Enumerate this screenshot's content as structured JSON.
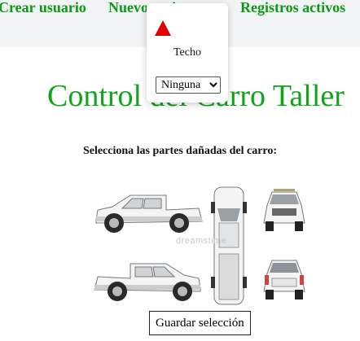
{
  "nav": {
    "links": [
      {
        "label": "Crear usuario"
      },
      {
        "label": "Nuevo registro"
      },
      {
        "label": "Registros activos"
      }
    ],
    "link_color": "#0a9a16"
  },
  "page": {
    "title": "Control del Carro Taller",
    "instruction": "Selecciona las partes dañadas del carro:",
    "save_button": "Guardar selección",
    "title_color": "#11a41a"
  },
  "car_views": [
    "left-side",
    "top",
    "front",
    "right-side",
    "rear"
  ],
  "watermark": "dreamstime",
  "popup": {
    "part_label": "Techo",
    "marker_color": "#e00000",
    "marker_icon": "warning-triangle-icon",
    "damage_options": [
      "Ninguna"
    ],
    "selected_damage": "Ninguna"
  }
}
